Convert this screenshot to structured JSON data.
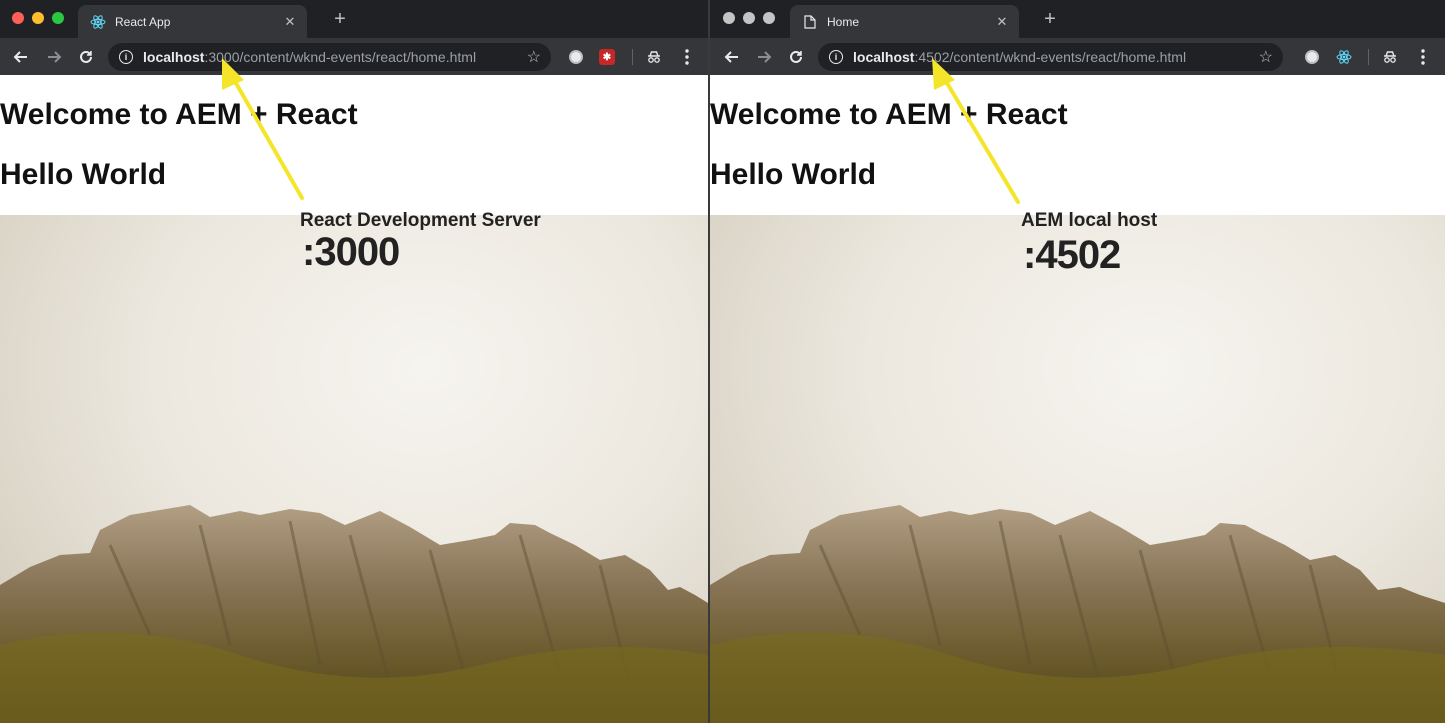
{
  "left_window": {
    "tab": {
      "title": "React App",
      "icon": "react-logo-icon"
    },
    "url": {
      "host": "localhost",
      "rest": ":3000/content/wknd-events/react/home.html"
    },
    "page": {
      "heading": "Welcome to AEM + React",
      "subheading": "Hello World"
    },
    "annotation": {
      "label": "React Development Server",
      "port": ":3000"
    }
  },
  "right_window": {
    "tab": {
      "title": "Home",
      "icon": "page-icon"
    },
    "url": {
      "host": "localhost",
      "rest": ":4502/content/wknd-events/react/home.html"
    },
    "page": {
      "heading": "Welcome to AEM + React",
      "subheading": "Hello World"
    },
    "annotation": {
      "label": "AEM local host",
      "port": ":4502"
    }
  },
  "colors": {
    "tabbar": "#202124",
    "toolbar": "#35363a",
    "arrow": "#f5e52a",
    "traffic_close": "#ff5f57",
    "traffic_min": "#febc2e",
    "traffic_max": "#28c840"
  }
}
